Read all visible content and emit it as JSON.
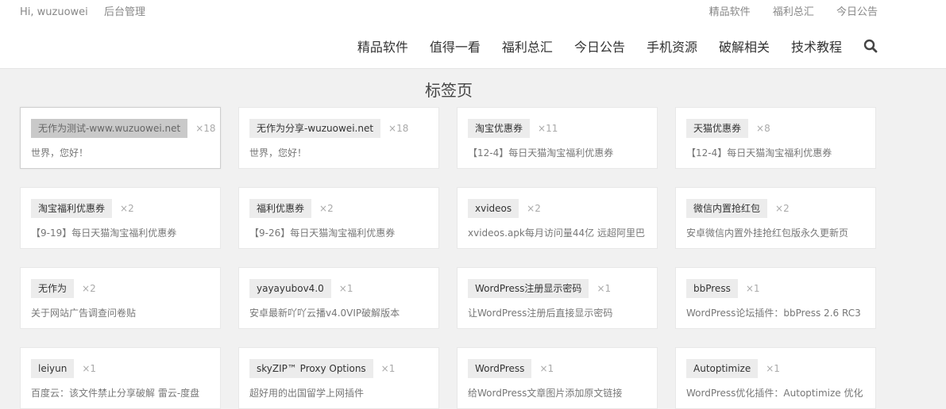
{
  "topbar": {
    "greeting": "Hi, wuzuowei",
    "admin": "后台管理",
    "links": [
      "精品软件",
      "福利总汇",
      "今日公告"
    ]
  },
  "nav": {
    "items": [
      "精品软件",
      "值得一看",
      "福利总汇",
      "今日公告",
      "手机资源",
      "破解相关",
      "技术教程"
    ]
  },
  "page_title": "标签页",
  "tags": [
    {
      "name": "无作为测试-www.wuzuowei.net",
      "count": "×18",
      "desc": "世界，您好！"
    },
    {
      "name": "无作为分享-wuzuowei.net",
      "count": "×18",
      "desc": "世界，您好！"
    },
    {
      "name": "淘宝优惠券",
      "count": "×11",
      "desc": "【12-4】每日天猫淘宝福利优惠券"
    },
    {
      "name": "天猫优惠券",
      "count": "×8",
      "desc": "【12-4】每日天猫淘宝福利优惠券"
    },
    {
      "name": "淘宝福利优惠券",
      "count": "×2",
      "desc": "【9-19】每日天猫淘宝福利优惠券"
    },
    {
      "name": "福利优惠券",
      "count": "×2",
      "desc": "【9-26】每日天猫淘宝福利优惠券"
    },
    {
      "name": "xvideos",
      "count": "×2",
      "desc": "xvideos.apk每月访问量44亿 远超阿里巴"
    },
    {
      "name": "微信内置抢红包",
      "count": "×2",
      "desc": "安卓微信内置外挂抢红包版永久更新页"
    },
    {
      "name": "无作为",
      "count": "×2",
      "desc": "关于网站广告调查问卷贴"
    },
    {
      "name": "yayayubov4.0",
      "count": "×1",
      "desc": "安卓最新吖吖云播v4.0VIP破解版本"
    },
    {
      "name": "WordPress注册显示密码",
      "count": "×1",
      "desc": "让WordPress注册后直接显示密码"
    },
    {
      "name": "bbPress",
      "count": "×1",
      "desc": "WordPress论坛插件：bbPress 2.6 RC3"
    },
    {
      "name": "leiyun",
      "count": "×1",
      "desc": "百度云：该文件禁止分享破解 雷云-度盘"
    },
    {
      "name": "skyZIP™ Proxy Options",
      "count": "×1",
      "desc": "超好用的出国留学上网插件"
    },
    {
      "name": "WordPress",
      "count": "×1",
      "desc": "给WordPress文章图片添加原文链接"
    },
    {
      "name": "Autoptimize",
      "count": "×1",
      "desc": "WordPress优化插件：Autoptimize 优化"
    }
  ],
  "icons": {
    "search": "search-icon"
  }
}
